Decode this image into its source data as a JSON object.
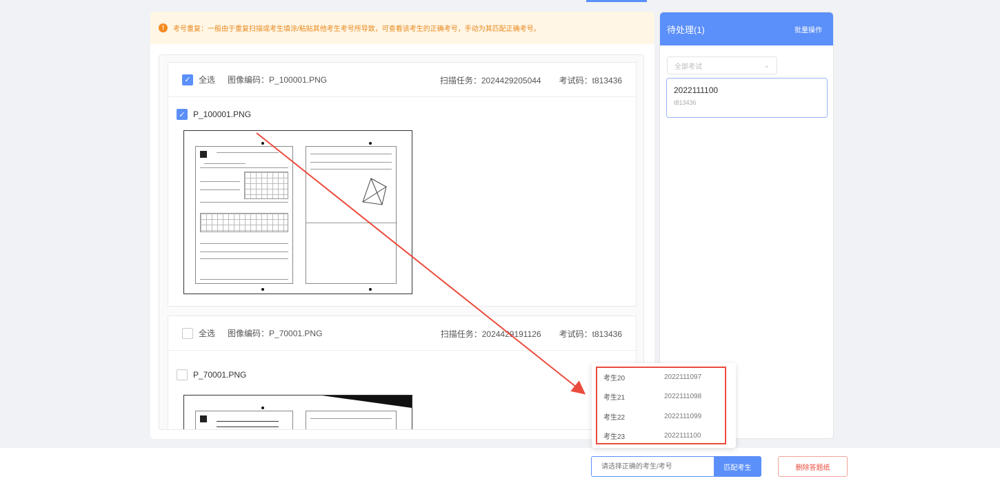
{
  "notice": {
    "icon": "warning-icon",
    "text": "考号重复：一般由于重复扫描或考生填涂/粘贴其他考生考号所导致，可查看该考生的正确考号，手动为其匹配正确考号。"
  },
  "blocks": [
    {
      "select_all_label": "全选",
      "image_code": "图像编码：P_100001.PNG",
      "scan_task": "扫描任务：2024429205044",
      "exam_code": "考试码：t813436",
      "file_name": "P_100001.PNG",
      "checked": true
    },
    {
      "select_all_label": "全选",
      "image_code": "图像编码：P_70001.PNG",
      "scan_task": "扫描任务：2024429191126",
      "exam_code": "考试码：t813436",
      "file_name": "P_70001.PNG",
      "checked": false
    }
  ],
  "pending": {
    "title": "待处理(1)",
    "batch_label": "批量操作",
    "exam_filter": "全部考试",
    "items": [
      {
        "id": "2022111100",
        "code": "t813436"
      }
    ]
  },
  "dropdown": {
    "options": [
      {
        "name": "考生20",
        "number": "2022111097"
      },
      {
        "name": "考生21",
        "number": "2022111098"
      },
      {
        "name": "考生22",
        "number": "2022111099"
      },
      {
        "name": "考生23",
        "number": "2022111100"
      }
    ]
  },
  "footer": {
    "search_placeholder": "请选择正确的考生/考号",
    "match_label": "匹配考生",
    "delete_label": "删除答题纸"
  },
  "colors": {
    "accent": "#5b8ff9",
    "warning": "#f58a1f",
    "danger": "#ea4b3c"
  }
}
